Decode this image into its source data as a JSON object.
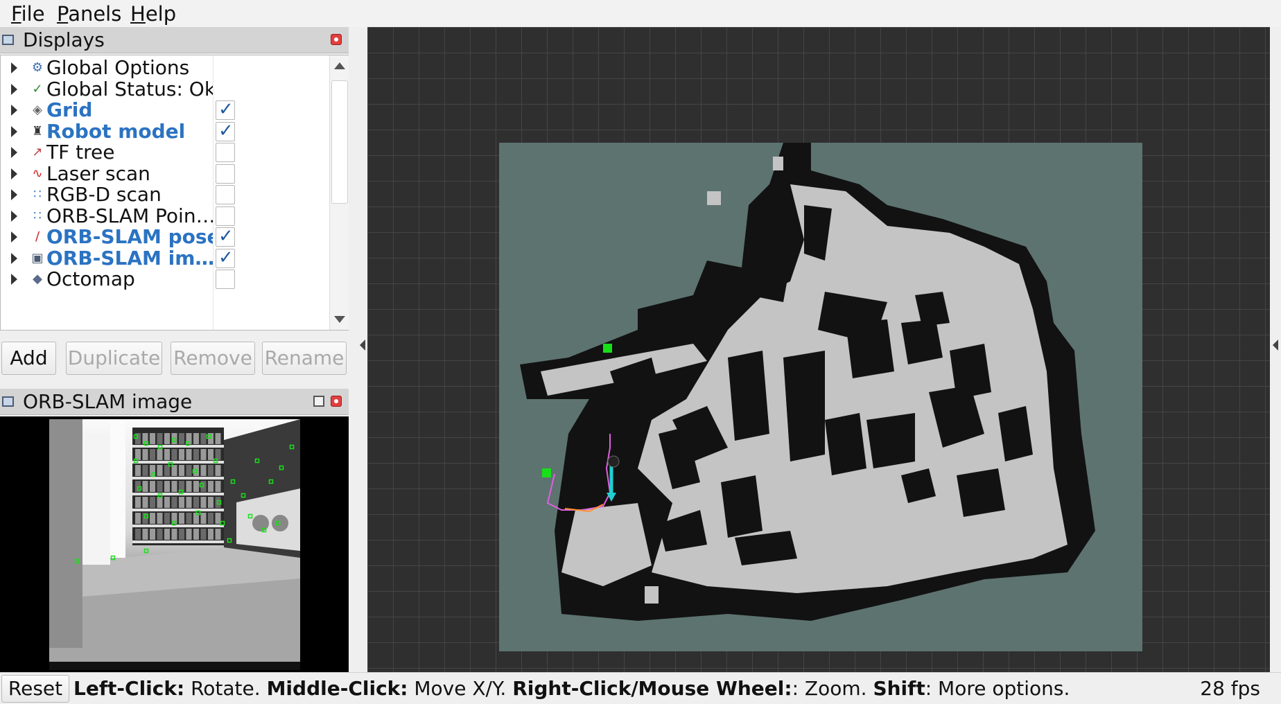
{
  "menu": [
    "File",
    "Panels",
    "Help"
  ],
  "displays_panel": {
    "title": "Displays",
    "items": [
      {
        "label": "Global Options",
        "icon": "gear-icon",
        "active": false,
        "checkbox": null
      },
      {
        "label": "Global Status: Ok",
        "icon": "check-icon",
        "active": false,
        "checkbox": null
      },
      {
        "label": "Grid",
        "icon": "grid-icon",
        "active": true,
        "checkbox": true
      },
      {
        "label": "Robot model",
        "icon": "robot-icon",
        "active": true,
        "checkbox": true
      },
      {
        "label": "TF tree",
        "icon": "axes-icon",
        "active": false,
        "checkbox": false
      },
      {
        "label": "Laser scan",
        "icon": "laser-icon",
        "active": false,
        "checkbox": false
      },
      {
        "label": "RGB-D scan",
        "icon": "pointcloud-icon",
        "active": false,
        "checkbox": false
      },
      {
        "label": "ORB-SLAM Poin…",
        "icon": "pointcloud-icon",
        "active": false,
        "checkbox": false
      },
      {
        "label": "ORB-SLAM pose",
        "icon": "pose-icon",
        "active": true,
        "checkbox": true
      },
      {
        "label": "ORB-SLAM im…",
        "icon": "image-icon",
        "active": true,
        "checkbox": true
      },
      {
        "label": "Octomap",
        "icon": "octomap-icon",
        "active": false,
        "checkbox": false
      }
    ],
    "buttons": {
      "add": "Add",
      "duplicate": "Duplicate",
      "remove": "Remove",
      "rename": "Rename"
    }
  },
  "image_panel": {
    "title": "ORB-SLAM image"
  },
  "statusbar": {
    "reset": "Reset",
    "hint_left_click": "Left-Click:",
    "hint_rotate": " Rotate. ",
    "hint_middle_click": "Middle-Click:",
    "hint_move": " Move X/Y. ",
    "hint_right_click": "Right-Click/Mouse Wheel:",
    "hint_zoom": ": Zoom. ",
    "hint_shift": "Shift",
    "hint_more": ": More options.",
    "fps": "28 fps"
  },
  "colors": {
    "active_label": "#2b73c2",
    "map_unknown": "#5d7370",
    "map_free": "#c4c4c4",
    "map_occupied": "#121212",
    "grid_bg": "#2f2f2f",
    "feature_points": "#18e018"
  }
}
